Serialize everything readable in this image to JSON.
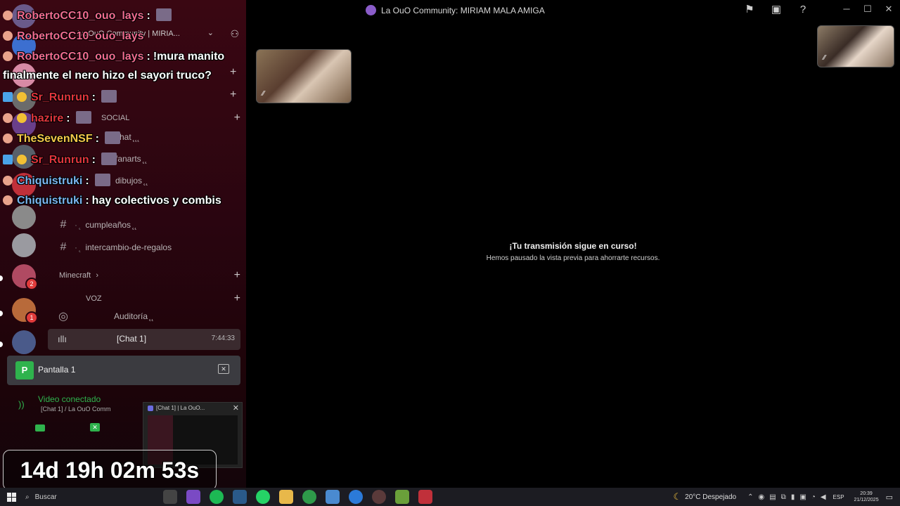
{
  "window": {
    "title": "La OuO Community: MIRIAM MALA AMIGA",
    "controls": {
      "minimize": "─",
      "maximize": "☐",
      "close": "✕"
    }
  },
  "server": {
    "name": "La OuO Community | MIRIA...",
    "channels": [
      {
        "label": "chat ̨ ̨ ̨",
        "icon": "#"
      },
      {
        "label": "fanarts ̨ ̨",
        "icon": "#"
      },
      {
        "label": "dibujos ̨ ̨",
        "icon": "#"
      },
      {
        "label": "cumpleaños ̨ ̨",
        "icon": "#"
      },
      {
        "label": "intercambio-de-regalos",
        "icon": "#"
      }
    ],
    "category_social": "SOCIAL",
    "category_minecraft": "Minecraft",
    "category_voz": "VOZ",
    "auditoria": "Auditoría ̨ ̨",
    "voice_channel": {
      "name": "[Chat 1]",
      "time": "7:44:33"
    }
  },
  "stream_card": {
    "label": "Pantalla 1"
  },
  "voice_connected": {
    "title": "Video conectado",
    "subtitle": "[Chat 1] / La OuO Comm"
  },
  "popup": {
    "title": "[Chat 1] | La OuO..."
  },
  "chat": [
    {
      "user": "RobertoCC10_ouo_lays",
      "text": "",
      "color": "pink"
    },
    {
      "user": "RobertoCC10_ouo_lays",
      "text": "",
      "color": "pink"
    },
    {
      "user": "RobertoCC10_ouo_lays",
      "text": "!mura manito",
      "color": "pink"
    },
    {
      "user": "",
      "text": "finalmente el nero hizo el sayori truco?",
      "color": "white"
    },
    {
      "user": "Sr_Runrun",
      "text": "",
      "color": "red"
    },
    {
      "user": "hazire",
      "text": "",
      "color": "red"
    },
    {
      "user": "TheSevenNSF",
      "text": "",
      "color": "gold"
    },
    {
      "user": "Sr_Runrun",
      "text": "",
      "color": "red"
    },
    {
      "user": "Chiquistruki",
      "text": "",
      "color": "blue"
    },
    {
      "user": "Chiquistruki",
      "text": "hay colectivos y combis",
      "color": "blue"
    }
  ],
  "timer": "14d 19h 02m 53s",
  "stream_status": {
    "heading": "¡Tu transmisión sigue en curso!",
    "subtext": "Hemos pausado la vista previa para ahorrarte recursos."
  },
  "taskbar": {
    "search_label": "Buscar",
    "weather": "20°C  Despejado",
    "language": "ESP",
    "time": "20:39",
    "date": "21/12/2025"
  },
  "colors": {
    "accent_green": "#2fb34d",
    "sidebar_bg": "#2a0510",
    "user_pink": "#f06b8f",
    "user_red": "#e2353d",
    "user_gold": "#f4c84a",
    "user_blue": "#7ab4ee"
  }
}
